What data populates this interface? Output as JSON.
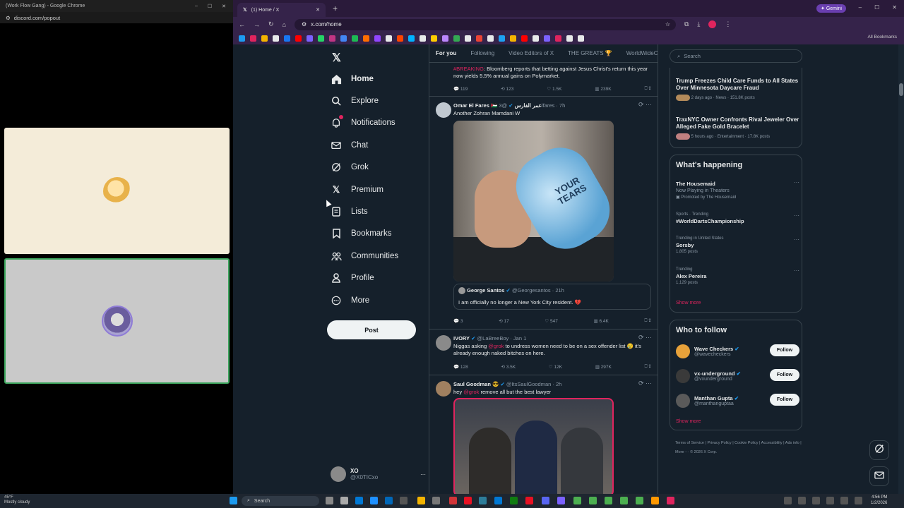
{
  "discord": {
    "window_title": "(Work Flow Gang) - Google Chrome",
    "url": "discord.com/popout"
  },
  "browser": {
    "tab_title": "(1) Home / X",
    "url": "x.com/home",
    "gemini_label": "Gemini",
    "all_bookmarks": "All Bookmarks",
    "bookmark_colors": [
      "#1d9bf0",
      "#e0245e",
      "#f4b400",
      "#e7e9ea",
      "#1877f2",
      "#ff0000",
      "#7b61ff",
      "#25d366",
      "#c13584",
      "#4285f4",
      "#1db954",
      "#ff6d00",
      "#9146ff",
      "#e7e9ea",
      "#ff4500",
      "#00b2ff",
      "#e7e9ea",
      "#ffcc00",
      "#bb86fc",
      "#34a853",
      "#e7e9ea",
      "#ea4335",
      "#e7e9ea",
      "#1da1f2",
      "#f4b400",
      "#ff0000",
      "#e7e9ea",
      "#7b61ff",
      "#e0245e",
      "#e7e9ea",
      "#e7e9ea"
    ]
  },
  "xnav": {
    "items": [
      {
        "label": "Home"
      },
      {
        "label": "Explore"
      },
      {
        "label": "Notifications"
      },
      {
        "label": "Chat"
      },
      {
        "label": "Grok"
      },
      {
        "label": "Premium"
      },
      {
        "label": "Lists"
      },
      {
        "label": "Bookmarks"
      },
      {
        "label": "Communities"
      },
      {
        "label": "Profile"
      },
      {
        "label": "More"
      }
    ],
    "post_label": "Post",
    "account": {
      "name": "XO",
      "handle": "@X0TICxo"
    }
  },
  "feed": {
    "tabs": [
      "For you",
      "Following",
      "Video Editors of X",
      "THE GREATS 🏆",
      "WorldWideCa"
    ],
    "tweet0": {
      "tag": "#BREAKING",
      "text": ": Bloomberg reports that betting against Jesus Christ's return this year now yields 5.5% annual gains on Polymarket.",
      "replies": "119",
      "reposts": "123",
      "likes": "1.5K",
      "views": "239K"
    },
    "tweet1": {
      "name": "Omar El Fares 🇵🇸 عمر الفارس",
      "handle": "@3lfares · 7h",
      "text": "Another Zohran Mamdani W",
      "image_text": "YOUR TEARS",
      "quote_name": "George Santos",
      "quote_handle": "@Georgesantos · 21h",
      "quote_text": "I am officially no longer a New York City resident. 💔",
      "replies": "3",
      "reposts": "17",
      "likes": "547",
      "views": "6.4K"
    },
    "tweet2": {
      "name": "IVORY",
      "handle": "@LaBreeBoy · Jan 1",
      "text_a": "Niggas asking ",
      "mention": "@grok",
      "text_b": " to undress women need to be on a sex offender list 😢 it's already enough naked bitches on here.",
      "replies": "128",
      "reposts": "3.5K",
      "likes": "12K",
      "views": "297K"
    },
    "tweet3": {
      "name": "Saul Goodman 😎",
      "handle": "@ItsSaulGoodman · 2h",
      "text_a": "hey ",
      "mention": "@grok",
      "text_b": " remove all but the best lawyer"
    }
  },
  "sidebar": {
    "search_placeholder": "Search",
    "news": [
      {
        "title": "Trump Freezes Child Care Funds to All States Over Minnesota Daycare Fraud",
        "meta": "2 days ago · News · 151.8K posts"
      },
      {
        "title": "TraxNYC Owner Confronts Rival Jeweler Over Alleged Fake Gold Bracelet",
        "meta": "5 hours ago · Entertainment · 17.8K posts"
      }
    ],
    "happening_title": "What's happening",
    "trends": [
      {
        "meta": "",
        "name": "The Housemaid",
        "sub": "Now Playing in Theaters",
        "promo": "Promoted by The Housemaid"
      },
      {
        "meta": "Sports · Trending",
        "name": "#WorldDartsChampionship",
        "sub": ""
      },
      {
        "meta": "Trending in United States",
        "name": "Sorsby",
        "sub": "1,805 posts"
      },
      {
        "meta": "Trending",
        "name": "Alex Pereira",
        "sub": "1,129 posts"
      }
    ],
    "show_more": "Show more",
    "wtf_title": "Who to follow",
    "wtf": [
      {
        "name": "Wave Checkers",
        "handle": "@wavecheckers",
        "btn": "Follow"
      },
      {
        "name": "vx-underground",
        "handle": "@vxunderground",
        "btn": "Follow"
      },
      {
        "name": "Manthan Gupta",
        "handle": "@manthanguptaa",
        "btn": "Follow"
      }
    ],
    "footer": "Terms of Service  |  Privacy Policy  |  Cookie Policy  |  Accessibility  |  Ads info  |  More ···  © 2026 X Corp."
  },
  "taskbar": {
    "weather_temp": "45°F",
    "weather_desc": "Mostly cloudy",
    "search": "Search",
    "time": "4:56 PM",
    "date": "1/2/2026"
  }
}
